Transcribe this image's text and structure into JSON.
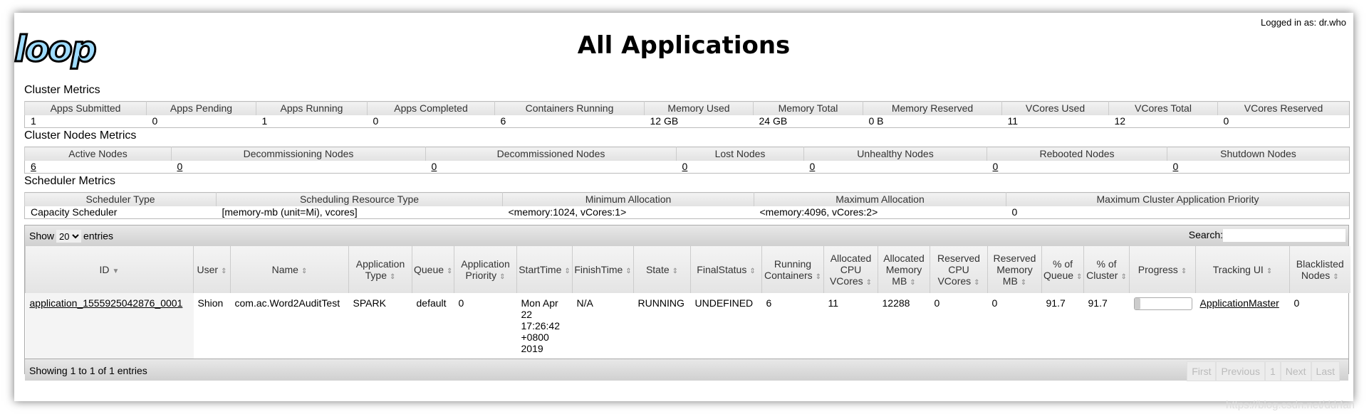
{
  "header": {
    "logo_text": "loop",
    "title": "All Applications",
    "logged_in": "Logged in as: dr.who"
  },
  "cluster_metrics": {
    "title": "Cluster Metrics",
    "headers": [
      "Apps Submitted",
      "Apps Pending",
      "Apps Running",
      "Apps Completed",
      "Containers Running",
      "Memory Used",
      "Memory Total",
      "Memory Reserved",
      "VCores Used",
      "VCores Total",
      "VCores Reserved"
    ],
    "values": [
      "1",
      "0",
      "1",
      "0",
      "6",
      "12 GB",
      "24 GB",
      "0 B",
      "11",
      "12",
      "0"
    ]
  },
  "nodes_metrics": {
    "title": "Cluster Nodes Metrics",
    "headers": [
      "Active Nodes",
      "Decommissioning Nodes",
      "Decommissioned Nodes",
      "Lost Nodes",
      "Unhealthy Nodes",
      "Rebooted Nodes",
      "Shutdown Nodes"
    ],
    "values": [
      "6",
      "0",
      "0",
      "0",
      "0",
      "0",
      "0"
    ]
  },
  "scheduler_metrics": {
    "title": "Scheduler Metrics",
    "headers": [
      "Scheduler Type",
      "Scheduling Resource Type",
      "Minimum Allocation",
      "Maximum Allocation",
      "Maximum Cluster Application Priority"
    ],
    "values": [
      "Capacity Scheduler",
      "[memory-mb (unit=Mi), vcores]",
      "<memory:1024, vCores:1>",
      "<memory:4096, vCores:2>",
      "0"
    ]
  },
  "apps": {
    "show_label": "Show",
    "entries_label": "entries",
    "page_size": "20",
    "search_label": "Search:",
    "search_value": "",
    "columns": [
      "ID",
      "User",
      "Name",
      "Application Type",
      "Queue",
      "Application Priority",
      "StartTime",
      "FinishTime",
      "State",
      "FinalStatus",
      "Running Containers",
      "Allocated CPU VCores",
      "Allocated Memory MB",
      "Reserved CPU VCores",
      "Reserved Memory MB",
      "% of Queue",
      "% of Cluster",
      "Progress",
      "Tracking UI",
      "Blacklisted Nodes"
    ],
    "rows": [
      {
        "id": "application_1555925042876_0001",
        "user": "Shion",
        "name": "com.ac.Word2AuditTest",
        "type": "SPARK",
        "queue": "default",
        "priority": "0",
        "start": "Mon Apr 22 17:26:42 +0800 2019",
        "finish": "N/A",
        "state": "RUNNING",
        "final": "UNDEFINED",
        "containers": "6",
        "cpu": "11",
        "mem": "12288",
        "rcpu": "0",
        "rmem": "0",
        "pqueue": "91.7",
        "pcluster": "91.7",
        "progress_pct": 10,
        "tracking": "ApplicationMaster",
        "blacklisted": "0"
      }
    ],
    "info": "Showing 1 to 1 of 1 entries",
    "pager": [
      "First",
      "Previous",
      "1",
      "Next",
      "Last"
    ]
  },
  "watermark": "https://blog.csdn.net/ddrfan"
}
